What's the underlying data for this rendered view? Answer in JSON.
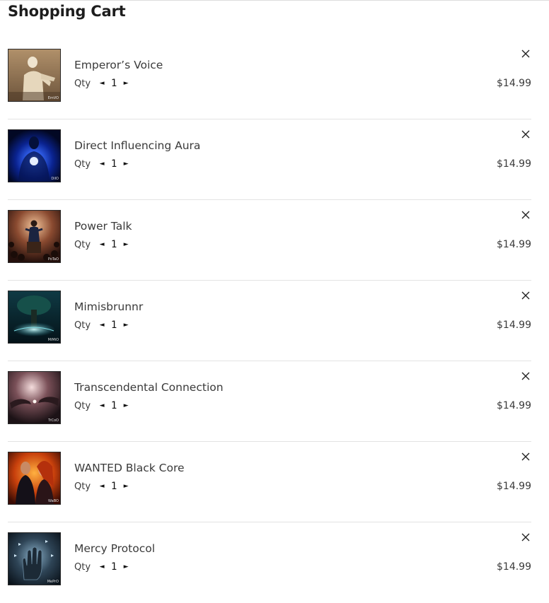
{
  "page": {
    "title": "Shopping Cart"
  },
  "cart": {
    "qty_label": "Qty",
    "decrement_symbol": "◄",
    "increment_symbol": "►",
    "remove_icon": "close-icon",
    "items": [
      {
        "name": "Emperor’s Voice",
        "qty": "1",
        "price": "$14.99",
        "thumb_tag": "EmVO",
        "colors": [
          "#9b7c5a",
          "#e8dcc4",
          "#3d2c1c"
        ]
      },
      {
        "name": "Direct Influencing Aura",
        "qty": "1",
        "price": "$14.99",
        "thumb_tag": "DiIO",
        "colors": [
          "#020a2e",
          "#2f5bff",
          "#0b1f7a"
        ]
      },
      {
        "name": "Power Talk",
        "qty": "1",
        "price": "$14.99",
        "thumb_tag": "PoTaO",
        "colors": [
          "#2a1410",
          "#e4a072",
          "#5a2a1c"
        ]
      },
      {
        "name": "Mimisbrunnr",
        "qty": "1",
        "price": "$14.99",
        "thumb_tag": "MiMiO",
        "colors": [
          "#061c24",
          "#5fc3c8",
          "#1c4a3a"
        ]
      },
      {
        "name": "Transcendental Connection",
        "qty": "1",
        "price": "$14.99",
        "thumb_tag": "TrCoO",
        "colors": [
          "#2a1c20",
          "#d9b0b8",
          "#5a3a40"
        ]
      },
      {
        "name": "WANTED Black Core",
        "qty": "1",
        "price": "$14.99",
        "thumb_tag": "WaBO",
        "colors": [
          "#3a0c04",
          "#ff7a1a",
          "#1a1010"
        ]
      },
      {
        "name": "Mercy Protocol",
        "qty": "1",
        "price": "$14.99",
        "thumb_tag": "MePrO",
        "colors": [
          "#0e1a24",
          "#6f9bb8",
          "#2a3a48"
        ]
      }
    ]
  }
}
